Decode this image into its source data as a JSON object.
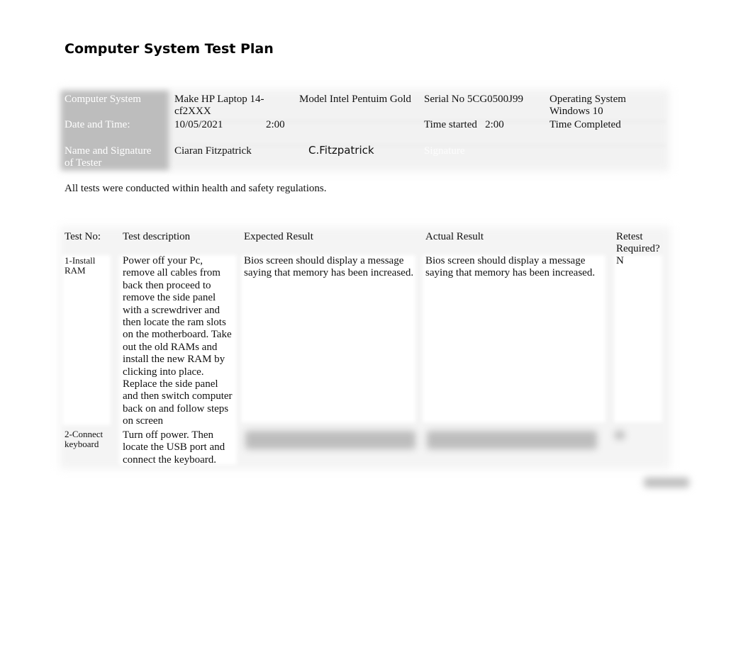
{
  "document": {
    "title": "Computer System Test Plan",
    "info": {
      "computer_system_label": "Computer System",
      "make": "Make HP Laptop 14-",
      "make_cont": "cf2XXX",
      "model": "Model Intel Pentuim Gold",
      "serial": "Serial No 5CG0500J99",
      "os_label": "Operating System",
      "os_value": "Windows 10",
      "date_time_label": "Date and Time:",
      "date": "10/05/2021",
      "time": "2:00",
      "time_started": "Time started   2:00",
      "time_completed": "Time Completed",
      "tester_label_1": "Name and Signature",
      "tester_label_2": "of Tester",
      "tester_name": "Ciaran Fitzpatrick",
      "tester_signature": "C.Fitzpatrick",
      "signature_label": "Signature"
    },
    "note": "All tests were conducted within health and safety regulations.",
    "tests": {
      "headers": {
        "test_no": "Test No:",
        "description": "Test description",
        "expected": "Expected Result",
        "actual": "Actual Result",
        "retest_1": "Retest",
        "retest_2": "Required?"
      },
      "rows": [
        {
          "no_1": "1-Install",
          "no_2": "RAM",
          "description_lines": [
            "Power off your Pc,",
            "remove all cables from",
            "back then proceed to",
            "remove the side panel",
            "with a screwdriver and",
            "then locate the ram slots",
            "on the motherboard. Take",
            "out the old RAMs and",
            "install the new RAM by",
            "clicking into place.",
            "Replace the side panel",
            "and then switch computer",
            "back on and follow steps",
            "on screen"
          ],
          "expected_1": "Bios screen should display a message",
          "expected_2": "saying that memory has been increased.",
          "actual_1": "Bios screen should display a message",
          "actual_2": "saying that memory has been increased.",
          "retest": "N"
        },
        {
          "no_1": "2-Connect",
          "no_2": "keyboard",
          "description_lines": [
            "Turn off power. Then",
            "locate the USB port and",
            "connect the keyboard."
          ]
        }
      ]
    }
  }
}
